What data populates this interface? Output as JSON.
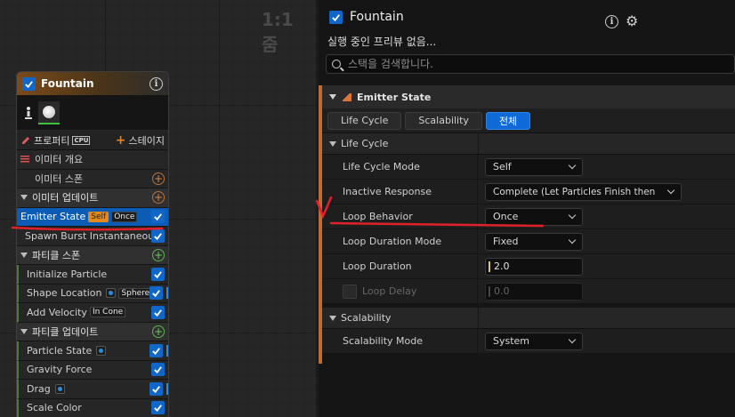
{
  "graph": {
    "zoom_label": "1:1 줌"
  },
  "node": {
    "title": "Fountain",
    "tools": {
      "properties_label": "프로퍼티",
      "cpu_label": "CPU",
      "stage_label": "스테이지"
    },
    "rows": [
      {
        "label": "이미터 개요"
      },
      {
        "label": "이미터 스폰"
      },
      {
        "label": "이미터 업데이트"
      },
      {
        "label": "Emitter State",
        "tags": [
          "Self",
          "Once"
        ]
      },
      {
        "label": "Spawn Burst Instantaneous"
      },
      {
        "label": "파티클 스폰"
      },
      {
        "label": "Initialize Particle"
      },
      {
        "label": "Shape Location",
        "tag": "Sphere"
      },
      {
        "label": "Add Velocity",
        "tag": "In Cone"
      },
      {
        "label": "파티클 업데이트"
      },
      {
        "label": "Particle State"
      },
      {
        "label": "Gravity Force"
      },
      {
        "label": "Drag"
      },
      {
        "label": "Scale Color"
      }
    ]
  },
  "details": {
    "title": "Fountain",
    "subtitle": "실행 중인 프리뷰 없음...",
    "search_placeholder": "스택을 검색합니다.",
    "section_title": "Emitter State",
    "tabs": [
      "Life Cycle",
      "Scalability",
      "전체"
    ],
    "active_tab": "전체",
    "categories": {
      "life_cycle": "Life Cycle",
      "scalability": "Scalability"
    },
    "properties": {
      "life_cycle_mode": {
        "label": "Life Cycle Mode",
        "value": "Self"
      },
      "inactive_response": {
        "label": "Inactive Response",
        "value": "Complete (Let Particles Finish then"
      },
      "loop_behavior": {
        "label": "Loop Behavior",
        "value": "Once"
      },
      "loop_duration_mode": {
        "label": "Loop Duration Mode",
        "value": "Fixed"
      },
      "loop_duration": {
        "label": "Loop Duration",
        "value": "2.0"
      },
      "loop_delay": {
        "label": "Loop Delay",
        "value": "0.0"
      },
      "scalability_mode": {
        "label": "Scalability Mode",
        "value": "System"
      }
    }
  },
  "colors": {
    "accent_blue": "#0f6ad8",
    "emitter_orange": "#c06a36",
    "annotation_red": "#e0202a"
  }
}
